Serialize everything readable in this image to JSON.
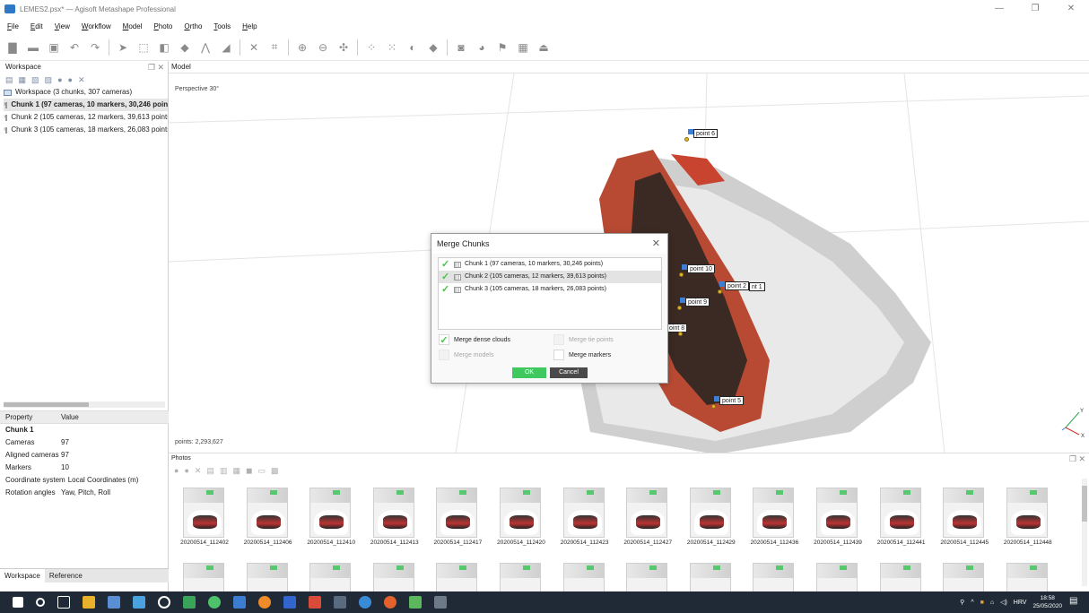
{
  "window": {
    "title": "LEMES2.psx* — Agisoft Metashape Professional",
    "minimize": "—",
    "restore": "❐",
    "close": "✕"
  },
  "menu": [
    "File",
    "Edit",
    "View",
    "Workflow",
    "Model",
    "Photo",
    "Ortho",
    "Tools",
    "Help"
  ],
  "workspace": {
    "title": "Workspace",
    "root": "Workspace (3 chunks, 307 cameras)",
    "chunks": [
      "Chunk 1 (97 cameras, 10 markers, 30,246 points)",
      "Chunk 2 (105 cameras, 12 markers, 39,613 points)",
      "Chunk 3 (105 cameras, 18 markers, 26,083 points)"
    ]
  },
  "properties": {
    "header_property": "Property",
    "header_value": "Value",
    "group": "Chunk 1",
    "rows": [
      {
        "k": "Cameras",
        "v": "97"
      },
      {
        "k": "Aligned cameras",
        "v": "97"
      },
      {
        "k": "Markers",
        "v": "10"
      },
      {
        "k": "Coordinate system",
        "v": "Local Coordinates (m)"
      },
      {
        "k": "Rotation angles",
        "v": "Yaw, Pitch, Roll"
      }
    ]
  },
  "left_tabs": [
    "Workspace",
    "Reference"
  ],
  "model": {
    "tab": "Model",
    "perspective": "Perspective 30°",
    "points": "points: 2,293,627",
    "markers": [
      "point 6",
      "point 10",
      "point 2",
      "nt 1",
      "point 9",
      "oint 8",
      "point 5"
    ],
    "axis_y": "Y",
    "axis_x": "X"
  },
  "dialog": {
    "title": "Merge Chunks",
    "close": "✕",
    "items": [
      "Chunk 1 (97 cameras, 10 markers, 30,246 points)",
      "Chunk 2 (105 cameras, 12 markers, 39,613 points)",
      "Chunk 3 (105 cameras, 18 markers, 26,083 points)"
    ],
    "merge_dense_clouds": "Merge dense clouds",
    "merge_tie_points": "Merge tie points",
    "merge_models": "Merge models",
    "merge_markers": "Merge markers",
    "ok": "OK",
    "cancel": "Cancel"
  },
  "photos": {
    "title": "Photos",
    "row1": [
      "20200514_112402",
      "20200514_112406",
      "20200514_112410",
      "20200514_112413",
      "20200514_112417",
      "20200514_112420",
      "20200514_112423",
      "20200514_112427",
      "20200514_112429",
      "20200514_112436",
      "20200514_112439",
      "20200514_112441",
      "20200514_112445",
      "20200514_112448"
    ]
  },
  "taskbar": {
    "lang": "HRV",
    "time": "18:58",
    "date": "25/05/2020"
  },
  "colors": {
    "accent_green": "#3fc85e",
    "marker_blue": "#3d7fd6",
    "taskbar": "#1f2a36"
  }
}
